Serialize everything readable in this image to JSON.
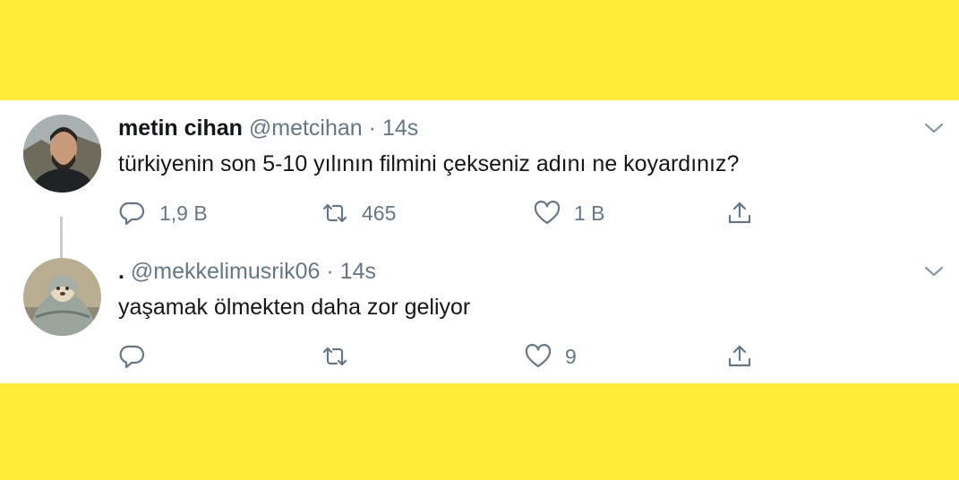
{
  "tweets": [
    {
      "name": "metin cihan",
      "handle": "@metcihan",
      "separator": "·",
      "time": "14s",
      "text": "türkiyenin son 5-10 yılının filmini çekseniz adını ne koyardınız?",
      "actions": {
        "reply": "1,9 B",
        "retweet": "465",
        "like": "1 B"
      }
    },
    {
      "name": ".",
      "handle": "@mekkelimusrik06",
      "separator": "·",
      "time": "14s",
      "text": "yaşamak ölmekten daha zor geliyor",
      "actions": {
        "reply": "",
        "retweet": "",
        "like": "9"
      }
    }
  ],
  "icons": [
    "reply-icon",
    "retweet-icon",
    "like-icon",
    "share-icon",
    "chevron-down-icon"
  ],
  "colors": {
    "background": "#ffeb38",
    "card": "#ffffff",
    "text": "#14171a",
    "muted": "#657786"
  }
}
